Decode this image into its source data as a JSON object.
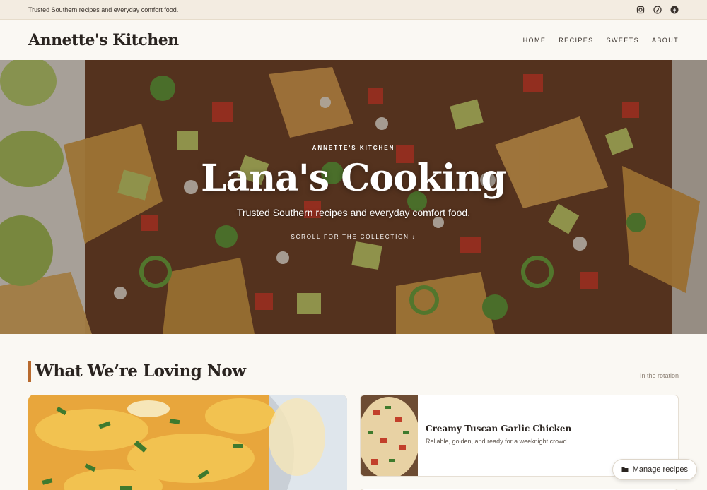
{
  "topbar": {
    "tagline": "Trusted Southern recipes and everyday comfort food.",
    "social_icons": [
      "instagram-icon",
      "pinterest-icon",
      "facebook-icon"
    ]
  },
  "nav": {
    "brand": "Annette's Kitchen",
    "items": [
      "HOME",
      "RECIPES",
      "SWEETS",
      "ABOUT"
    ]
  },
  "hero": {
    "kicker": "ANNETTE'S KITCHEN",
    "title": "Lana's Cooking",
    "subtitle": "Trusted Southern recipes and everyday comfort food.",
    "scroll_label": "SCROLL FOR THE COLLECTION ↓"
  },
  "section": {
    "title": "What We’re Loving Now",
    "note": "In the rotation"
  },
  "cards": [
    {
      "title": "Creamy Tuscan Garlic Chicken",
      "description": "Reliable, golden, and ready for a weeknight crowd."
    }
  ],
  "manage_button": {
    "label": "Manage recipes"
  },
  "colors": {
    "accent": "#b86a2e",
    "background": "#faf8f3",
    "topbar": "#f3ece1"
  }
}
